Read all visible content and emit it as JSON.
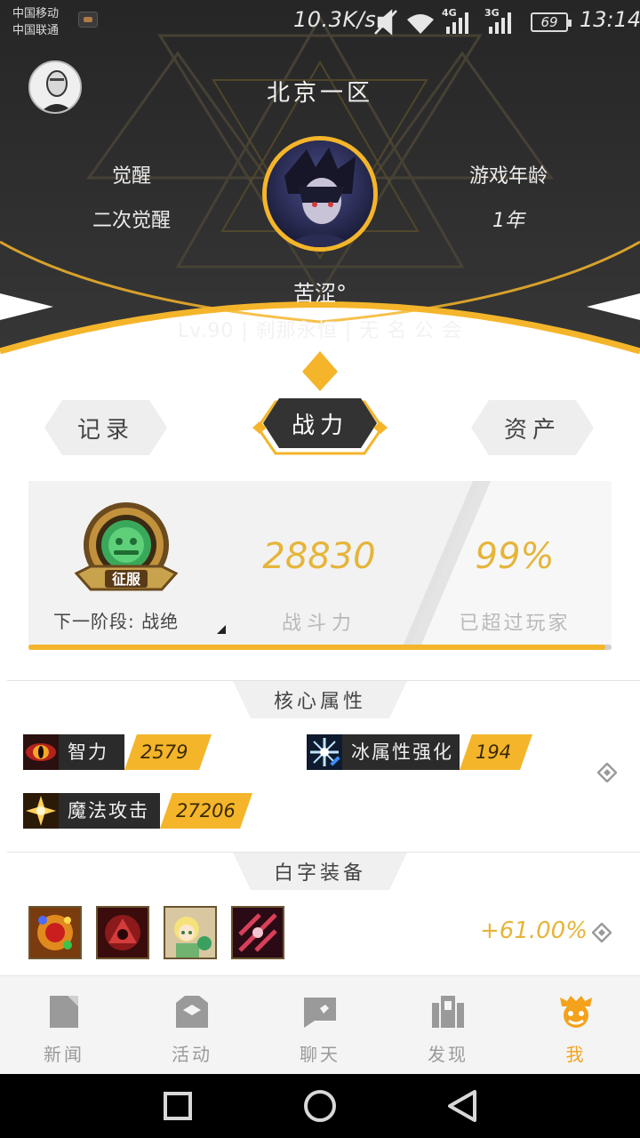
{
  "status_bar": {
    "carrier_1": "中国移动",
    "carrier_2": "中国联通",
    "net_speed": "10.3K/s",
    "signal_1": "4G",
    "signal_2": "3G",
    "battery": "69",
    "time": "13:14"
  },
  "header": {
    "server": "北京一区",
    "left_label": "觉醒",
    "left_value": "二次觉醒",
    "right_label": "游戏年龄",
    "right_value": "1年",
    "player_name": "苦涩°",
    "player_info": "Lv.90 | 刹那永恒 | 无 名 公 会"
  },
  "tabs": {
    "left": "记录",
    "center": "战力",
    "right": "资产"
  },
  "power_card": {
    "badge_label": "征服",
    "next_stage": "下一阶段: 战绝",
    "power_value": "28830",
    "power_label": "战斗力",
    "percent_value": "99%",
    "percent_label": "已超过玩家",
    "progress_fraction": 0.99
  },
  "core_attributes": {
    "title": "核心属性",
    "items": [
      {
        "name": "智力",
        "value": "2579",
        "icon": "red-eye-icon"
      },
      {
        "name": "冰属性强化",
        "value": "194",
        "icon": "ice-crystal-icon"
      },
      {
        "name": "魔法攻击",
        "value": "27206",
        "icon": "magic-burst-icon"
      }
    ]
  },
  "equipment": {
    "title": "白字装备",
    "bonus": "+61.00%"
  },
  "bottom_nav": {
    "items": [
      {
        "label": "新闻",
        "icon": "news-icon"
      },
      {
        "label": "活动",
        "icon": "activity-icon"
      },
      {
        "label": "聊天",
        "icon": "chat-icon"
      },
      {
        "label": "发现",
        "icon": "discover-icon"
      },
      {
        "label": "我",
        "icon": "me-icon"
      }
    ]
  },
  "colors": {
    "accent": "#f4b52b",
    "header_bg": "#2d2d2d",
    "value_gold": "#e5b53a",
    "nav_active": "#f4a21b"
  }
}
